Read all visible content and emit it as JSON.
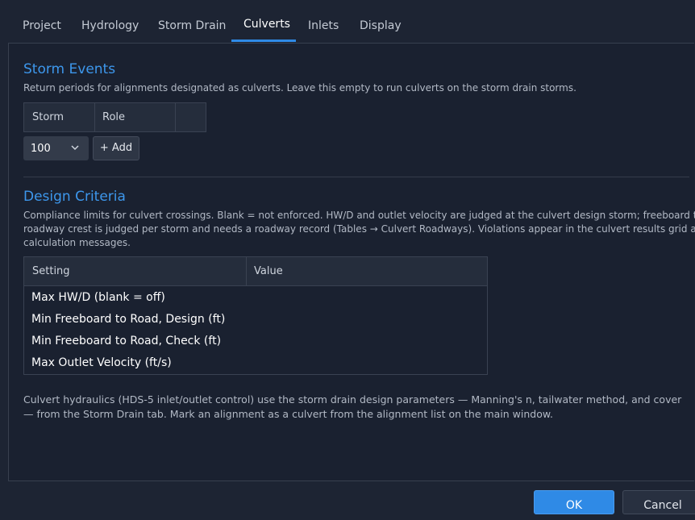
{
  "tabs": [
    {
      "label": "Project"
    },
    {
      "label": "Hydrology"
    },
    {
      "label": "Storm Drain"
    },
    {
      "label": "Culverts"
    },
    {
      "label": "Inlets"
    },
    {
      "label": "Display"
    }
  ],
  "active_tab": "Culverts",
  "storm_events": {
    "title": "Storm Events",
    "description": "Return periods for alignments designated as culverts. Leave this empty to run culverts on the storm drain storms.",
    "columns": [
      "Storm",
      "Role"
    ],
    "storm_select_value": "100",
    "add_button_label": "+ Add"
  },
  "design_criteria": {
    "title": "Design Criteria",
    "description_lines": [
      "Compliance limits for culvert crossings. Blank = not enforced. HW/D and outlet velocity are judged at the culvert design storm; freeboard to the",
      "roadway crest is judged per storm and needs a roadway record (Tables → Culvert Roadways). Violations appear in the culvert results grid and the",
      "calculation messages."
    ],
    "columns": [
      "Setting",
      "Value"
    ],
    "rows": [
      {
        "setting": "Max HW/D (blank = off)",
        "value": ""
      },
      {
        "setting": "Min Freeboard to Road, Design (ft)",
        "value": ""
      },
      {
        "setting": "Min Freeboard to Road, Check (ft)",
        "value": ""
      },
      {
        "setting": "Max Outlet Velocity (ft/s)",
        "value": ""
      }
    ]
  },
  "footnote_lines": [
    "Culvert hydraulics (HDS-5 inlet/outlet control) use the storm drain design parameters — Manning's n, tailwater method, and cover",
    "— from the Storm Drain tab. Mark an alignment as a culvert from the alignment list on the main window."
  ],
  "dialog_buttons": {
    "ok": "OK",
    "cancel": "Cancel"
  },
  "colors": {
    "accent": "#2f8ae6",
    "section_title": "#3d97ec",
    "background": "#1d2433"
  }
}
